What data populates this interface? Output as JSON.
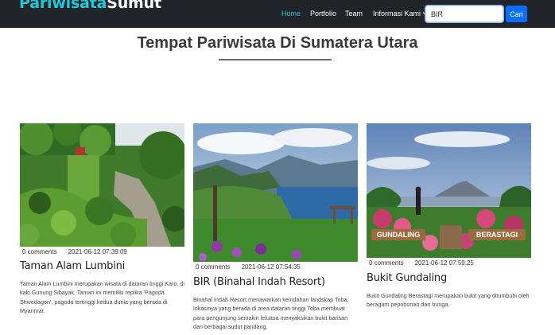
{
  "navbar": {
    "brand_part1": "Pariwisata",
    "brand_part2": "Sumut",
    "links": [
      {
        "label": "Home"
      },
      {
        "label": "Portfolio"
      },
      {
        "label": "Team"
      },
      {
        "label": "Informasi Kami"
      }
    ],
    "search_value": "BIR",
    "search_button": "Cari",
    "brand_color": "#21c8d9",
    "active_color": "#2ec4d8",
    "button_color": "#0d6efd"
  },
  "page": {
    "title": "Tempat Pariwisata Di Sumatera Utara"
  },
  "cards": [
    {
      "image": "lumbini-garden-photo",
      "comments": "0 comments",
      "date": "2021-06-12 07:39:09",
      "title": "Taman Alam Lumbini",
      "description": "Taman Alam Lumbini merupakan wisata di dataran tinggi Karo, di kaki Gunung Sibayak. Taman ini memiliki replika 'Pagoda Shwedagon', pagoda tertinggi kedua dunia yang berada di Myanmar."
    },
    {
      "image": "binahal-indah-resort-photo",
      "comments": "0 comments",
      "date": "2021-06-12 07:54:35",
      "title": "BIR (Binahal Indah Resort)",
      "description": "Binahal Indah Resort menawarkan keindahan landskap Toba, lokasinya yang berada di area dataran tinggi Toba membuat para pengunjung semakin leluasa menyaksikan bukit barisan dari berbagai sudut pandang."
    },
    {
      "image": "bukit-gundaling-photo",
      "comments": "0 comments",
      "date": "2021-06-12 07:59:25",
      "title": "Bukit Gundaling",
      "description": "Bukit Gundaling Berastagi merupakan bukit yang ditumbuhi oleh beragam pepohonan dan bunga.",
      "sign_left": "GUNDALING",
      "sign_right": "BERASTAGI"
    }
  ]
}
